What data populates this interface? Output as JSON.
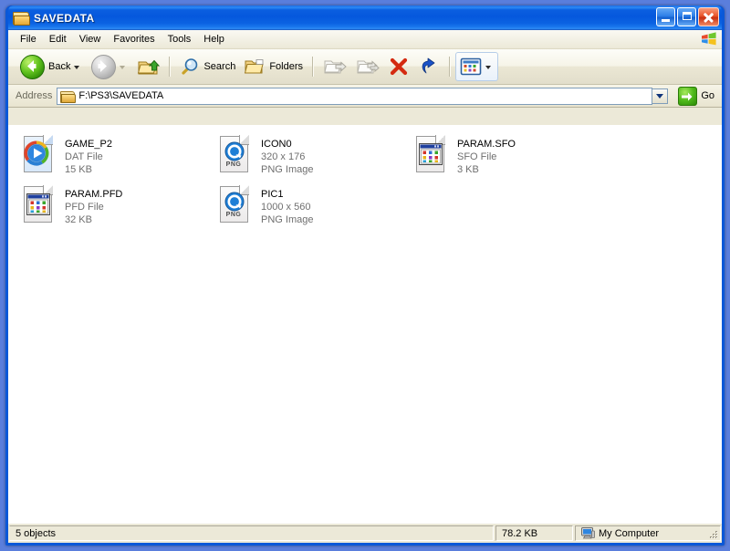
{
  "window": {
    "title": "SAVEDATA",
    "title_icon": "folder-icon",
    "controls": {
      "minimize": "Minimize",
      "maximize": "Maximize",
      "close": "Close"
    }
  },
  "menubar": {
    "items": [
      {
        "label": "File"
      },
      {
        "label": "Edit"
      },
      {
        "label": "View"
      },
      {
        "label": "Favorites"
      },
      {
        "label": "Tools"
      },
      {
        "label": "Help"
      }
    ],
    "logo": "windows-flag-icon"
  },
  "toolbar": {
    "back": {
      "label": "Back",
      "icon": "back-arrow-icon",
      "enabled": true
    },
    "forward": {
      "label": "Forward",
      "icon": "forward-arrow-icon",
      "enabled": false
    },
    "up": {
      "label": "Up",
      "icon": "up-folder-icon"
    },
    "search": {
      "label": "Search",
      "icon": "magnifier-icon"
    },
    "folders": {
      "label": "Folders",
      "icon": "folders-icon"
    },
    "move_to": {
      "label": "Move To",
      "icon": "move-to-folder-icon",
      "enabled": false
    },
    "copy_to": {
      "label": "Copy To",
      "icon": "copy-to-folder-icon",
      "enabled": false
    },
    "delete": {
      "label": "Delete",
      "icon": "red-x-icon"
    },
    "undo": {
      "label": "Undo",
      "icon": "undo-arrow-icon"
    },
    "views": {
      "label": "Views",
      "icon": "views-icon"
    }
  },
  "address": {
    "label": "Address",
    "value": "F:\\PS3\\SAVEDATA",
    "icon": "folder-icon",
    "dropdown": "chevron-down-icon",
    "go_label": "Go",
    "go_icon": "go-arrow-icon"
  },
  "files": [
    {
      "name": "GAME_P2",
      "line2": "DAT File",
      "line3": "15 KB",
      "icon": "media-player-file-icon"
    },
    {
      "name": "ICON0",
      "line2": "320 x 176",
      "line3": "PNG Image",
      "icon": "png-image-file-icon"
    },
    {
      "name": "PARAM.SFO",
      "line2": "SFO File",
      "line3": "3 KB",
      "icon": "generic-application-file-icon"
    },
    {
      "name": "PARAM.PFD",
      "line2": "PFD File",
      "line3": "32 KB",
      "icon": "generic-application-file-icon"
    },
    {
      "name": "PIC1",
      "line2": "1000 x 560",
      "line3": "PNG Image",
      "icon": "png-image-file-icon"
    }
  ],
  "statusbar": {
    "objects": "5 objects",
    "size": "78.2 KB",
    "location": "My Computer",
    "location_icon": "my-computer-icon"
  },
  "colors": {
    "title_blue": "#0558dd",
    "frame_blue": "#0a58d8",
    "chrome": "#ece9d8",
    "content_bg": "#ffffff",
    "close_red": "#e8542a",
    "accent_green": "#4fb91a",
    "subtext_grey": "#6f6f6f"
  }
}
